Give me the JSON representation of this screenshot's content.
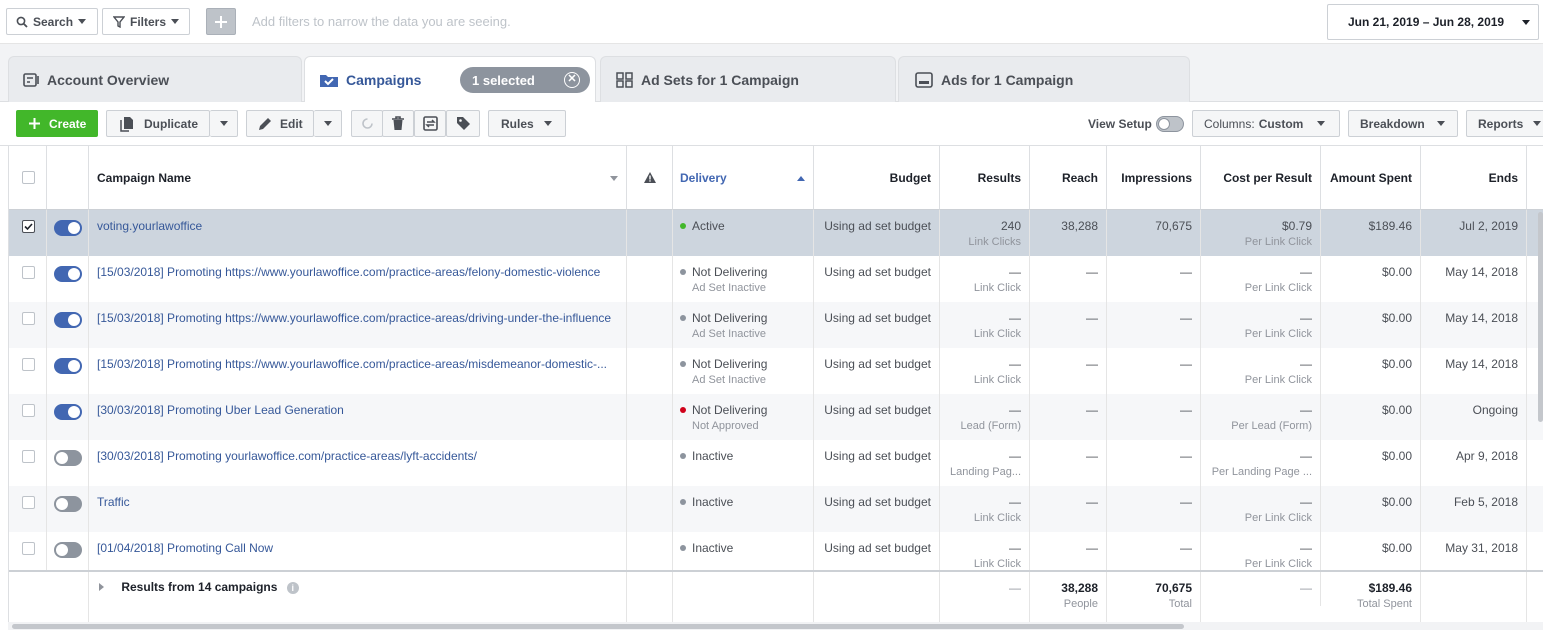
{
  "topbar": {
    "search_label": "Search",
    "filters_label": "Filters",
    "hint": "Add filters to narrow the data you are seeing.",
    "date_range": "Jun 21, 2019 – Jun 28, 2019"
  },
  "tabs": {
    "account_overview": "Account Overview",
    "campaigns": "Campaigns",
    "selected_pill": "1 selected",
    "ad_sets": "Ad Sets for 1 Campaign",
    "ads": "Ads for 1 Campaign"
  },
  "toolbar": {
    "create": "Create",
    "duplicate": "Duplicate",
    "edit": "Edit",
    "rules": "Rules",
    "view_setup": "View Setup",
    "columns_prefix": "Columns:",
    "columns_value": "Custom",
    "breakdown": "Breakdown",
    "reports": "Reports"
  },
  "columns": {
    "name": "Campaign Name",
    "delivery": "Delivery",
    "budget": "Budget",
    "results": "Results",
    "reach": "Reach",
    "impressions": "Impressions",
    "cost": "Cost per Result",
    "spent": "Amount Spent",
    "ends": "Ends"
  },
  "rows": [
    {
      "name": "voting.yourlawoffice",
      "on": true,
      "checked": true,
      "status": "Active",
      "status_sub": "",
      "dot": "green",
      "budget": "Using ad set budget",
      "results": "240",
      "results_sub": "Link Clicks",
      "reach": "38,288",
      "impressions": "70,675",
      "cost": "$0.79",
      "cost_sub": "Per Link Click",
      "spent": "$189.46",
      "ends": "Jul 2, 2019"
    },
    {
      "name": "[15/03/2018] Promoting https://www.yourlawoffice.com/practice-areas/felony-domestic-violence",
      "on": true,
      "checked": false,
      "status": "Not Delivering",
      "status_sub": "Ad Set Inactive",
      "dot": "grey",
      "budget": "Using ad set budget",
      "results": "—",
      "results_sub": "Link Click",
      "reach": "—",
      "impressions": "—",
      "cost": "—",
      "cost_sub": "Per Link Click",
      "spent": "$0.00",
      "ends": "May 14, 2018"
    },
    {
      "name": "[15/03/2018] Promoting https://www.yourlawoffice.com/practice-areas/driving-under-the-influence",
      "on": true,
      "checked": false,
      "status": "Not Delivering",
      "status_sub": "Ad Set Inactive",
      "dot": "grey",
      "budget": "Using ad set budget",
      "results": "—",
      "results_sub": "Link Click",
      "reach": "—",
      "impressions": "—",
      "cost": "—",
      "cost_sub": "Per Link Click",
      "spent": "$0.00",
      "ends": "May 14, 2018"
    },
    {
      "name": "[15/03/2018] Promoting https://www.yourlawoffice.com/practice-areas/misdemeanor-domestic-...",
      "on": true,
      "checked": false,
      "status": "Not Delivering",
      "status_sub": "Ad Set Inactive",
      "dot": "grey",
      "budget": "Using ad set budget",
      "results": "—",
      "results_sub": "Link Click",
      "reach": "—",
      "impressions": "—",
      "cost": "—",
      "cost_sub": "Per Link Click",
      "spent": "$0.00",
      "ends": "May 14, 2018"
    },
    {
      "name": "[30/03/2018] Promoting Uber Lead Generation",
      "on": true,
      "checked": false,
      "status": "Not Delivering",
      "status_sub": "Not Approved",
      "dot": "red",
      "budget": "Using ad set budget",
      "results": "—",
      "results_sub": "Lead (Form)",
      "reach": "—",
      "impressions": "—",
      "cost": "—",
      "cost_sub": "Per Lead (Form)",
      "spent": "$0.00",
      "ends": "Ongoing"
    },
    {
      "name": "[30/03/2018] Promoting yourlawoffice.com/practice-areas/lyft-accidents/",
      "on": false,
      "checked": false,
      "status": "Inactive",
      "status_sub": "",
      "dot": "grey",
      "budget": "Using ad set budget",
      "results": "—",
      "results_sub": "Landing Pag...",
      "reach": "—",
      "impressions": "—",
      "cost": "—",
      "cost_sub": "Per Landing Page ...",
      "spent": "$0.00",
      "ends": "Apr 9, 2018"
    },
    {
      "name": "Traffic",
      "on": false,
      "checked": false,
      "status": "Inactive",
      "status_sub": "",
      "dot": "grey",
      "budget": "Using ad set budget",
      "results": "—",
      "results_sub": "Link Click",
      "reach": "—",
      "impressions": "—",
      "cost": "—",
      "cost_sub": "Per Link Click",
      "spent": "$0.00",
      "ends": "Feb 5, 2018"
    },
    {
      "name": "[01/04/2018] Promoting Call Now",
      "on": false,
      "checked": false,
      "status": "Inactive",
      "status_sub": "",
      "dot": "grey",
      "budget": "Using ad set budget",
      "results": "—",
      "results_sub": "Link Click",
      "reach": "—",
      "impressions": "—",
      "cost": "—",
      "cost_sub": "Per Link Click",
      "spent": "$0.00",
      "ends": "May 31, 2018"
    }
  ],
  "footer": {
    "label": "Results from 14 campaigns",
    "results": "—",
    "reach": "38,288",
    "reach_sub": "People",
    "impressions": "70,675",
    "impressions_sub": "Total",
    "cost": "—",
    "spent": "$189.46",
    "spent_sub": "Total Spent"
  }
}
